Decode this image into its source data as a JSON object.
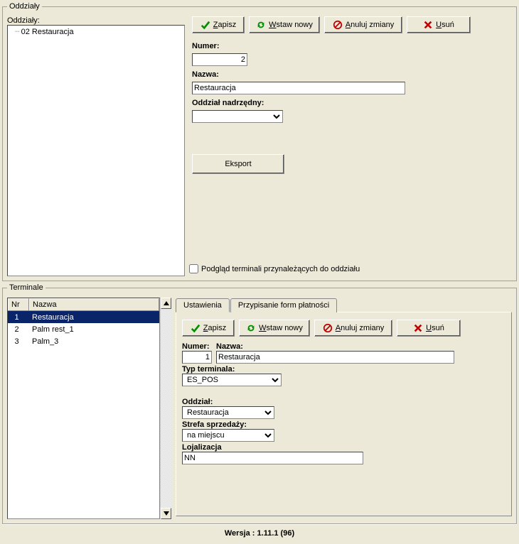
{
  "oddzialy": {
    "legend": "Oddziały",
    "tree_label": "Oddziały:",
    "tree_item": "02 Restauracja",
    "form": {
      "numer_label": "Numer:",
      "numer_value": "2",
      "nazwa_label": "Nazwa:",
      "nazwa_value": "Restauracja",
      "nadrz_label": "Oddział nadrzędny:",
      "nadrz_value": ""
    },
    "eksport_label": "Eksport",
    "checkbox_label": "Podgląd terminali przynależących do oddziału"
  },
  "buttons": {
    "zapisz_pre": "",
    "zapisz_u": "Z",
    "zapisz_rest": "apisz",
    "wstaw_pre": "",
    "wstaw_u": "W",
    "wstaw_rest": "staw nowy",
    "anuluj_pre": "",
    "anuluj_u": "A",
    "anuluj_rest": "nuluj zmiany",
    "usun_pre": "",
    "usun_u": "U",
    "usun_rest": "suń"
  },
  "terminale": {
    "legend": "Terminale",
    "col_nr": "Nr",
    "col_nazwa": "Nazwa",
    "rows": [
      {
        "nr": "1",
        "nazwa": "Restauracja",
        "selected": true
      },
      {
        "nr": "2",
        "nazwa": "Palm rest_1",
        "selected": false
      },
      {
        "nr": "3",
        "nazwa": "Palm_3",
        "selected": false
      }
    ],
    "tabs": {
      "ustawienia": "Ustawienia",
      "przypisanie": "Przypisanie form płatności"
    },
    "form": {
      "numer_label": "Numer:",
      "numer_value": "1",
      "nazwa_label": "Nazwa:",
      "nazwa_value": "Restauracja",
      "typ_label": "Typ terminala:",
      "typ_value": "ES_POS",
      "oddzial_label": "Oddział:",
      "oddzial_value": "Restauracja",
      "strefa_label": "Strefa sprzedaży:",
      "strefa_value": "na miejscu",
      "loj_label": "Lojalizacja",
      "loj_value": "NN"
    }
  },
  "version": "Wersja :  1.11.1 (96)"
}
